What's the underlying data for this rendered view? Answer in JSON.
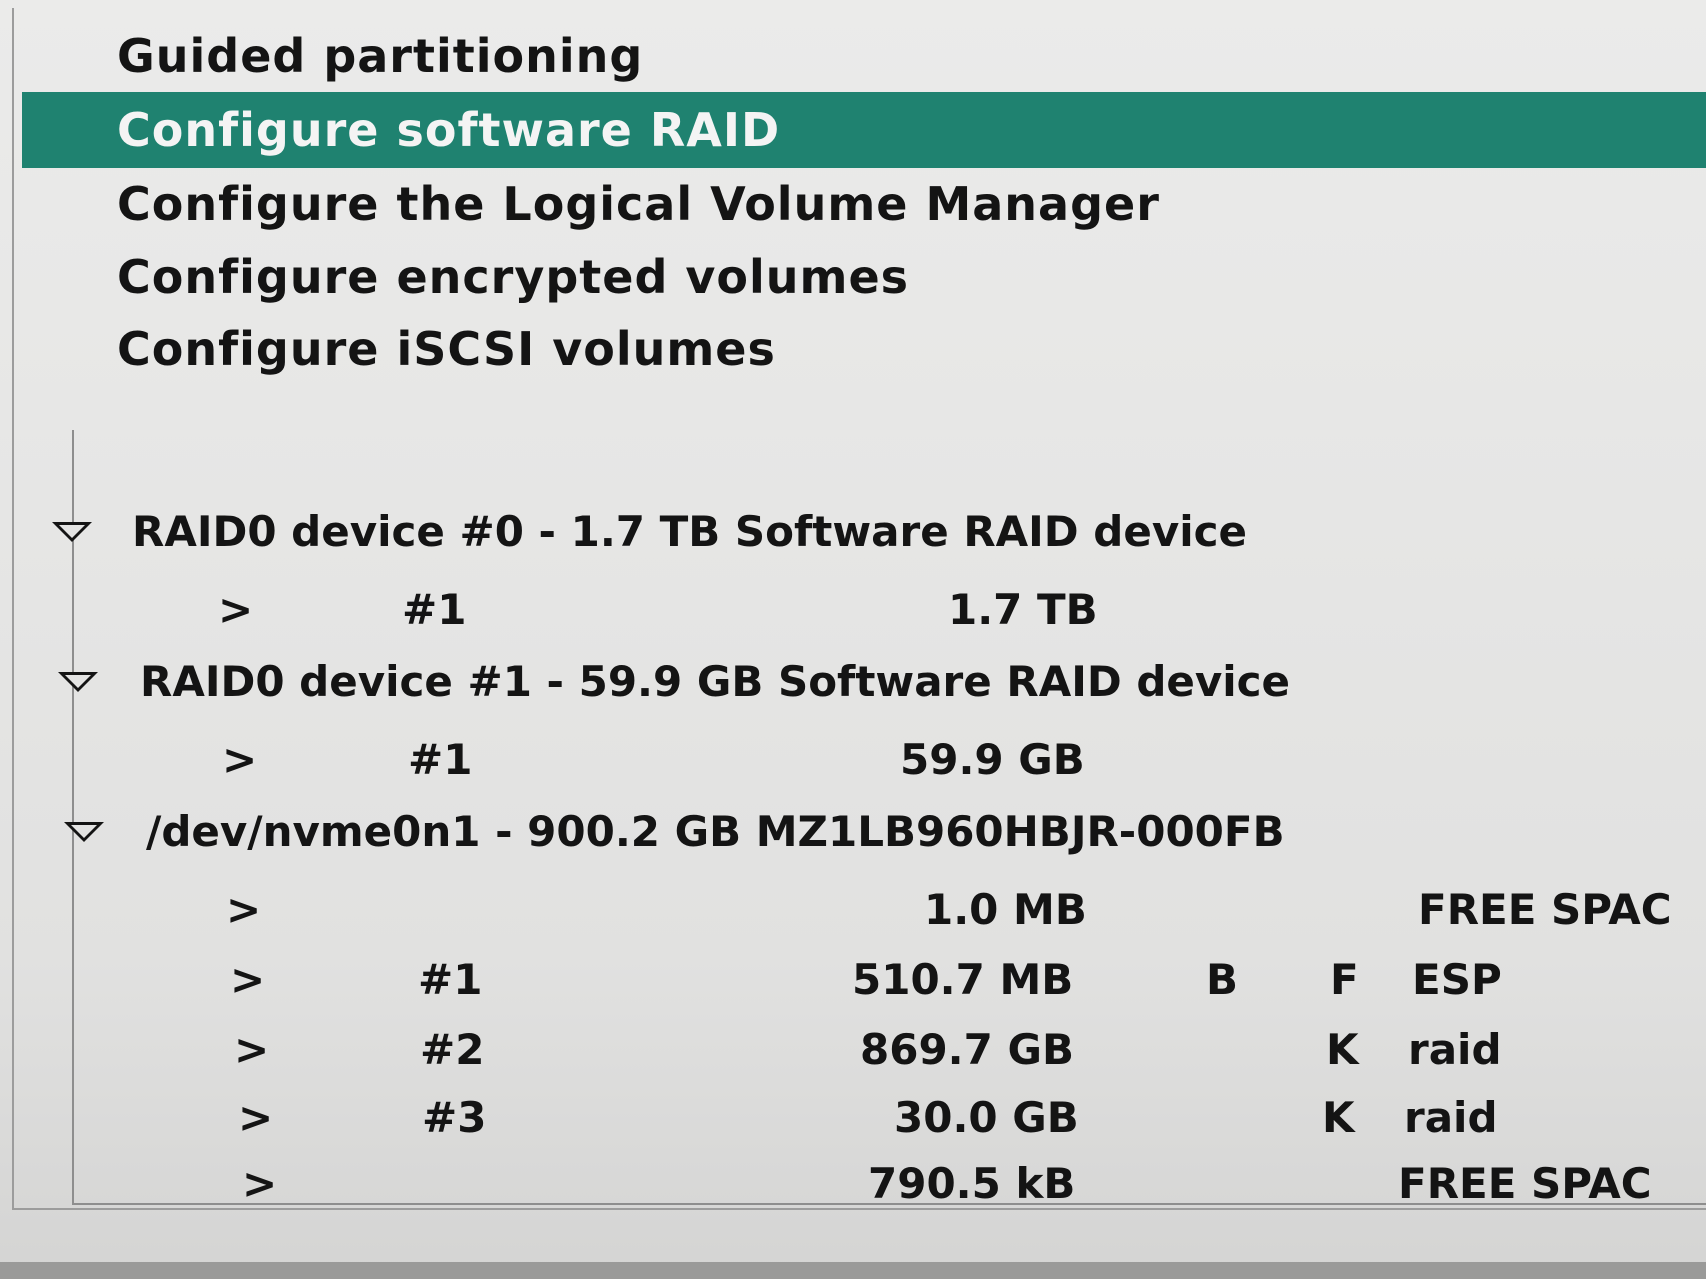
{
  "menu": [
    {
      "label": "Guided partitioning"
    },
    {
      "label": "Configure software RAID",
      "selected": true
    },
    {
      "label": "Configure the Logical Volume Manager"
    },
    {
      "label": "Configure encrypted volumes"
    },
    {
      "label": "Configure iSCSI volumes"
    }
  ],
  "devices": [
    {
      "title": "RAID0 device #0 - 1.7 TB Software RAID device",
      "partitions": [
        {
          "arrow": ">",
          "num": "#1",
          "size": "1.7 TB",
          "flag1": "",
          "flag2": "",
          "type": ""
        }
      ]
    },
    {
      "title": "RAID0 device #1 - 59.9 GB Software RAID device",
      "partitions": [
        {
          "arrow": ">",
          "num": "#1",
          "size": "59.9 GB",
          "flag1": "",
          "flag2": "",
          "type": ""
        }
      ]
    },
    {
      "title": "/dev/nvme0n1 - 900.2 GB MZ1LB960HBJR-000FB",
      "partitions": [
        {
          "arrow": ">",
          "num": "",
          "size": "1.0 MB",
          "flag1": "",
          "flag2": "",
          "type": "FREE SPAC"
        },
        {
          "arrow": ">",
          "num": "#1",
          "size": "510.7 MB",
          "flag1": "B",
          "flag2": "F",
          "type": "ESP"
        },
        {
          "arrow": ">",
          "num": "#2",
          "size": "869.7 GB",
          "flag1": "",
          "flag2": "K",
          "type": "raid"
        },
        {
          "arrow": ">",
          "num": "#3",
          "size": "30.0 GB",
          "flag1": "",
          "flag2": "K",
          "type": "raid"
        },
        {
          "arrow": ">",
          "num": "",
          "size": "790.5 kB",
          "flag1": "",
          "flag2": "",
          "type": "FREE SPAC"
        }
      ]
    }
  ],
  "colors": {
    "selection": "#1f8270",
    "text": "#141414",
    "selected_text": "#f4f4f4"
  }
}
